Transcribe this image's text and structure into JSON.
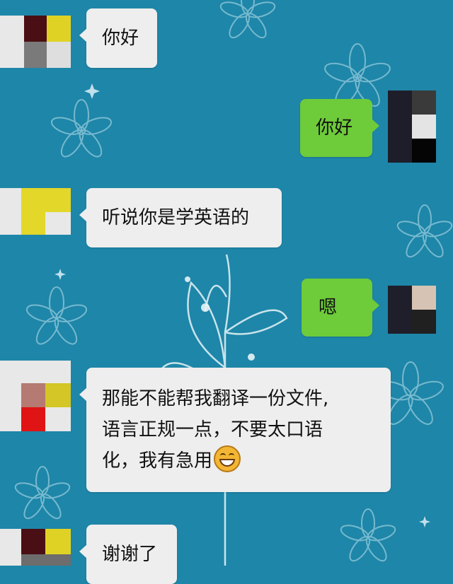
{
  "colors": {
    "background": "#1e86a8",
    "received_bubble": "#eeeeee",
    "sent_bubble": "#6ecb3a"
  },
  "messages": [
    {
      "direction": "received",
      "text": "你好"
    },
    {
      "direction": "sent",
      "text": "你好"
    },
    {
      "direction": "received",
      "text": "听说你是学英语的"
    },
    {
      "direction": "sent",
      "text": "嗯"
    },
    {
      "direction": "received",
      "lines": [
        "那能不能帮我翻译一份文件,",
        "语言正规一点，不要太口语",
        "化，我有急用"
      ],
      "emoji": "grinning-face-icon"
    },
    {
      "direction": "received",
      "text": "谢谢了"
    }
  ]
}
